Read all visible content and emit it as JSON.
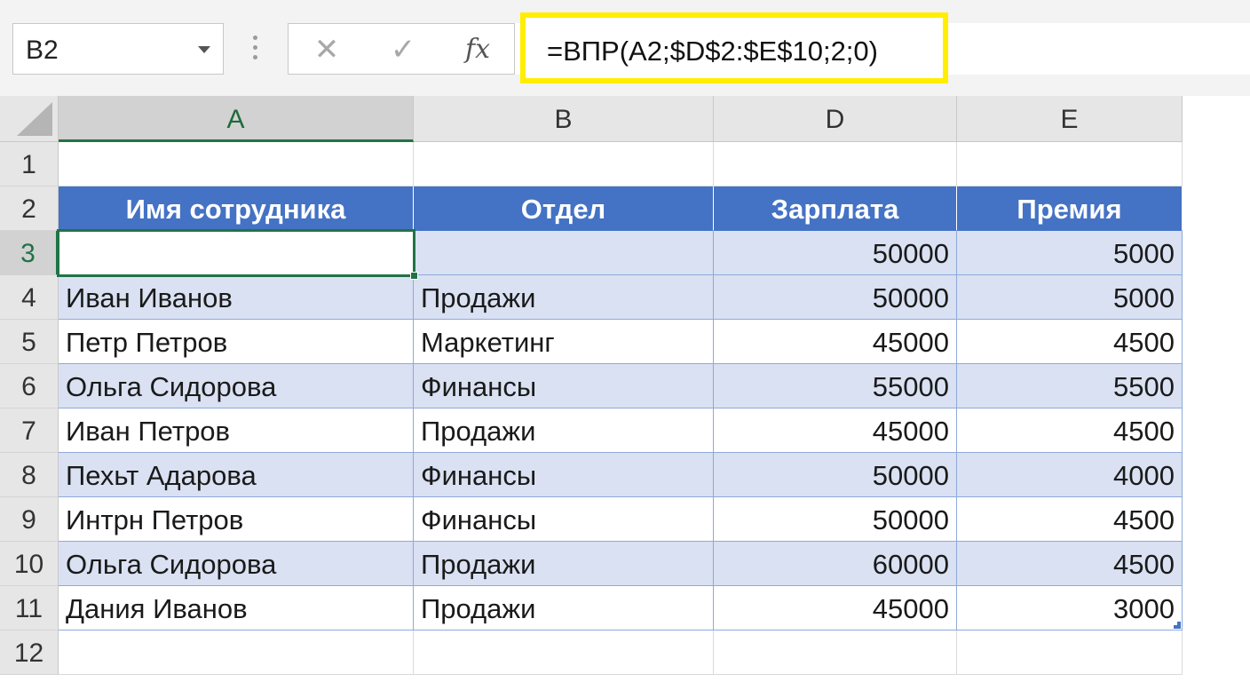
{
  "formula_bar": {
    "name_box": "B2",
    "cancel_icon": "✕",
    "enter_icon": "✓",
    "fx_label": "fx",
    "formula": "=ВПР(A2;$D$2:$E$10;2;0)",
    "highlight_color": "#ffee00"
  },
  "columns": [
    "A",
    "B",
    "D",
    "E"
  ],
  "rows": [
    "1",
    "2",
    "3",
    "4",
    "5",
    "6",
    "7",
    "8",
    "9",
    "10",
    "11",
    "12"
  ],
  "table": {
    "header": [
      "Имя сотрудника",
      "Отдел",
      "Зарплата",
      "Премия"
    ],
    "header_color": "#4472c4",
    "band_color": "#d9e1f2",
    "rows": [
      [
        "",
        "",
        "50000",
        "5000"
      ],
      [
        "Иван Иванов",
        "Продажи",
        "50000",
        "5000"
      ],
      [
        "Петр Петров",
        "Маркетинг",
        "45000",
        "4500"
      ],
      [
        "Ольга Сидорова",
        "Финансы",
        "55000",
        "5500"
      ],
      [
        "Иван Петров",
        "Продажи",
        "45000",
        "4500"
      ],
      [
        "Пехьт Адарова",
        "Финансы",
        "50000",
        "4000"
      ],
      [
        "Интрн Петров",
        "Финансы",
        "50000",
        "4500"
      ],
      [
        "Ольга Сидорова",
        "Продажи",
        "60000",
        "4500"
      ],
      [
        "Дания Иванов",
        "Продажи",
        "45000",
        "3000"
      ]
    ]
  }
}
